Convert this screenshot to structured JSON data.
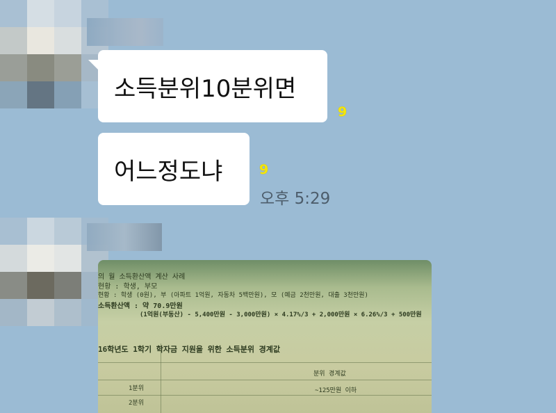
{
  "chat": {
    "messages": [
      {
        "text": "소득분위10분위면",
        "unread": "9"
      },
      {
        "text": "어느정도냐",
        "unread": "9",
        "time": "오후 5:29"
      }
    ],
    "photo": {
      "lines": [
        "의 월 소득환산액 계산 사례",
        "현황 : 학생, 부모",
        "현황 : 학생 (0원), 부 (아파트 1억원, 자동차 5백만원), 모 (예금 2천만원, 대출 3천만원)",
        "소득환산액 : 약 70.9만원",
        "(1억원(부동산) - 5,400만원 - 3,000만원) × 4.17%/3 + 2,000만원 × 6.26%/3 + 500만원",
        "16학년도 1학기 학자금 지원을 위한 소득분위 경계값",
        "분위 경계값",
        "1분위",
        "~125만원 이하",
        "2분위"
      ]
    }
  },
  "colors": {
    "background": "#9bbbd4",
    "bubble": "#ffffff",
    "unread": "#f5e60a",
    "time": "#4d5d6b"
  }
}
